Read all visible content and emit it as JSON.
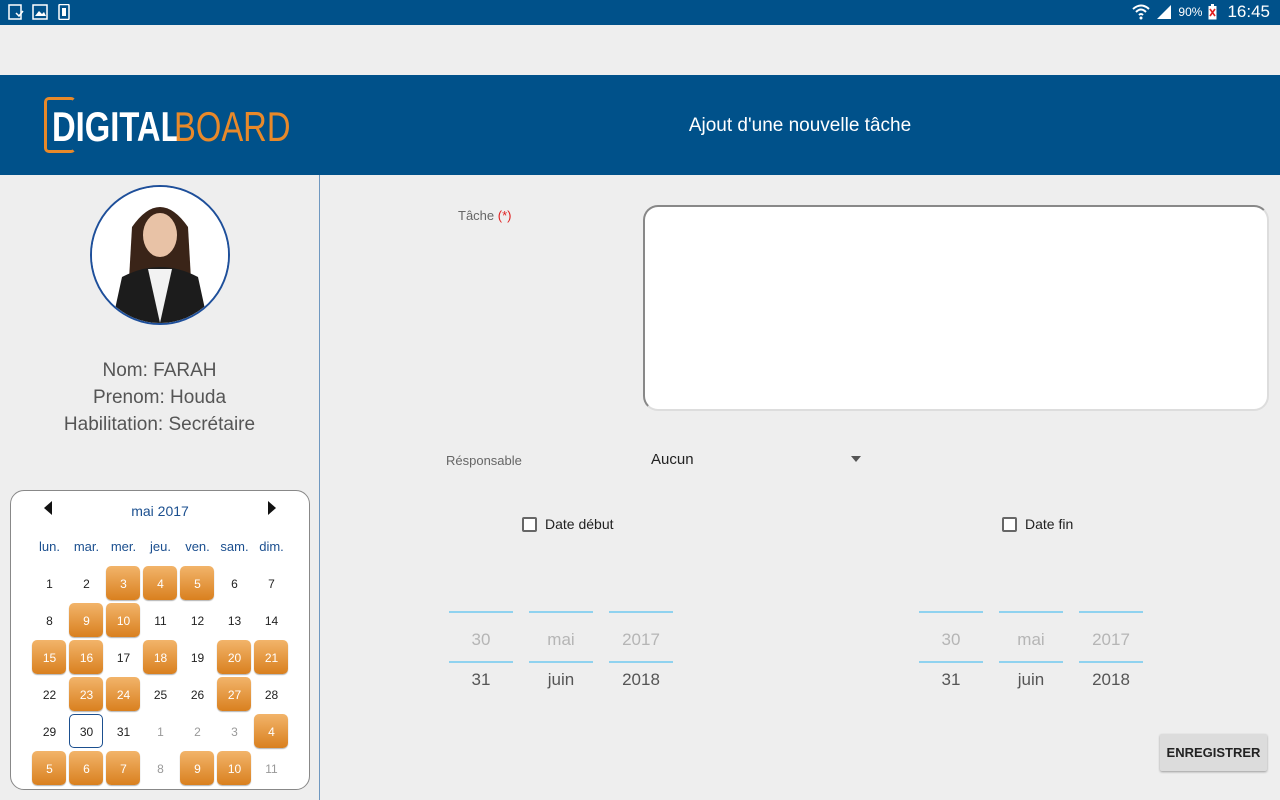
{
  "status_bar": {
    "battery_percent": "90%",
    "time": "16:45",
    "icons": [
      "download-done-icon",
      "image-icon",
      "phone-icon",
      "wifi-icon",
      "signal-icon",
      "battery-icon"
    ]
  },
  "header": {
    "logo_digital": "DIGITAL",
    "logo_board": "BOARD",
    "title": "Ajout d'une nouvelle tâche",
    "colors": {
      "bar": "#00518a",
      "accent": "#e8892a"
    }
  },
  "profile": {
    "nom": "Nom: FARAH",
    "prenom": "Prenom: Houda",
    "habilitation": "Habilitation: Secrétaire"
  },
  "calendar": {
    "month_label": "mai 2017",
    "weekdays": [
      "lun.",
      "mar.",
      "mer.",
      "jeu.",
      "ven.",
      "sam.",
      "dim."
    ],
    "days": [
      {
        "d": "1",
        "hl": false,
        "muted": false
      },
      {
        "d": "2",
        "hl": false,
        "muted": false
      },
      {
        "d": "3",
        "hl": true,
        "muted": false
      },
      {
        "d": "4",
        "hl": true,
        "muted": false
      },
      {
        "d": "5",
        "hl": true,
        "muted": false
      },
      {
        "d": "6",
        "hl": false,
        "muted": false
      },
      {
        "d": "7",
        "hl": false,
        "muted": false
      },
      {
        "d": "8",
        "hl": false,
        "muted": false
      },
      {
        "d": "9",
        "hl": true,
        "muted": false
      },
      {
        "d": "10",
        "hl": true,
        "muted": false
      },
      {
        "d": "11",
        "hl": false,
        "muted": false
      },
      {
        "d": "12",
        "hl": false,
        "muted": false
      },
      {
        "d": "13",
        "hl": false,
        "muted": false
      },
      {
        "d": "14",
        "hl": false,
        "muted": false
      },
      {
        "d": "15",
        "hl": true,
        "muted": false
      },
      {
        "d": "16",
        "hl": true,
        "muted": false
      },
      {
        "d": "17",
        "hl": false,
        "muted": false
      },
      {
        "d": "18",
        "hl": true,
        "muted": false
      },
      {
        "d": "19",
        "hl": false,
        "muted": false
      },
      {
        "d": "20",
        "hl": true,
        "muted": false
      },
      {
        "d": "21",
        "hl": true,
        "muted": false
      },
      {
        "d": "22",
        "hl": false,
        "muted": false
      },
      {
        "d": "23",
        "hl": true,
        "muted": false
      },
      {
        "d": "24",
        "hl": true,
        "muted": false
      },
      {
        "d": "25",
        "hl": false,
        "muted": false
      },
      {
        "d": "26",
        "hl": false,
        "muted": false
      },
      {
        "d": "27",
        "hl": true,
        "muted": false
      },
      {
        "d": "28",
        "hl": false,
        "muted": false
      },
      {
        "d": "29",
        "hl": false,
        "muted": false
      },
      {
        "d": "30",
        "hl": false,
        "muted": false,
        "today": true
      },
      {
        "d": "31",
        "hl": false,
        "muted": false
      },
      {
        "d": "1",
        "hl": false,
        "muted": true
      },
      {
        "d": "2",
        "hl": false,
        "muted": true
      },
      {
        "d": "3",
        "hl": false,
        "muted": true
      },
      {
        "d": "4",
        "hl": true,
        "muted": true
      },
      {
        "d": "5",
        "hl": true,
        "muted": true
      },
      {
        "d": "6",
        "hl": true,
        "muted": true
      },
      {
        "d": "7",
        "hl": true,
        "muted": true
      },
      {
        "d": "8",
        "hl": false,
        "muted": true
      },
      {
        "d": "9",
        "hl": true,
        "muted": true
      },
      {
        "d": "10",
        "hl": true,
        "muted": true
      },
      {
        "d": "11",
        "hl": false,
        "muted": true
      }
    ]
  },
  "form": {
    "tache_label": "Tâche",
    "required_mark": "(*)",
    "tache_value": "",
    "responsable_label": "Résponsable",
    "responsable_value": "Aucun",
    "date_debut_label": "Date début",
    "date_fin_label": "Date fin",
    "date_debut": {
      "day": {
        "prev": "30",
        "selected": "31"
      },
      "month": {
        "prev": "mai",
        "selected": "juin"
      },
      "year": {
        "prev": "2017",
        "selected": "2018"
      }
    },
    "date_fin": {
      "day": {
        "prev": "30",
        "selected": "31"
      },
      "month": {
        "prev": "mai",
        "selected": "juin"
      },
      "year": {
        "prev": "2017",
        "selected": "2018"
      }
    },
    "save_label": "ENREGISTRER"
  }
}
